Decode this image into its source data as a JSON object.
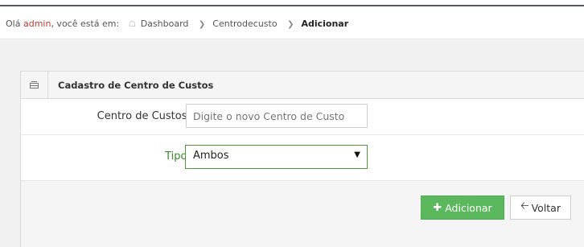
{
  "breadcrumb": {
    "greeting": "Olá",
    "user": "admin",
    "suffix": ", você está em:",
    "items": [
      "Dashboard",
      "Centrodecusto",
      "Adicionar"
    ]
  },
  "panel": {
    "title": "Cadastro de Centro de Custos"
  },
  "form": {
    "centro_label": "Centro de Custos*",
    "centro_placeholder": "Digite o novo Centro de Custo",
    "centro_value": "",
    "tipo_label": "Tipo*",
    "tipo_value": "Ambos"
  },
  "actions": {
    "add_label": "Adicionar",
    "back_label": "Voltar"
  },
  "icons": {
    "home": "home-icon",
    "panel": "form-icon",
    "add": "plus-icon",
    "back": "arrow-left-icon",
    "select": "dropdown-arrow-icon"
  },
  "colors": {
    "user": "#c0392b",
    "accent_green": "#5cb85c",
    "tipo_label": "#3c8a2e"
  }
}
